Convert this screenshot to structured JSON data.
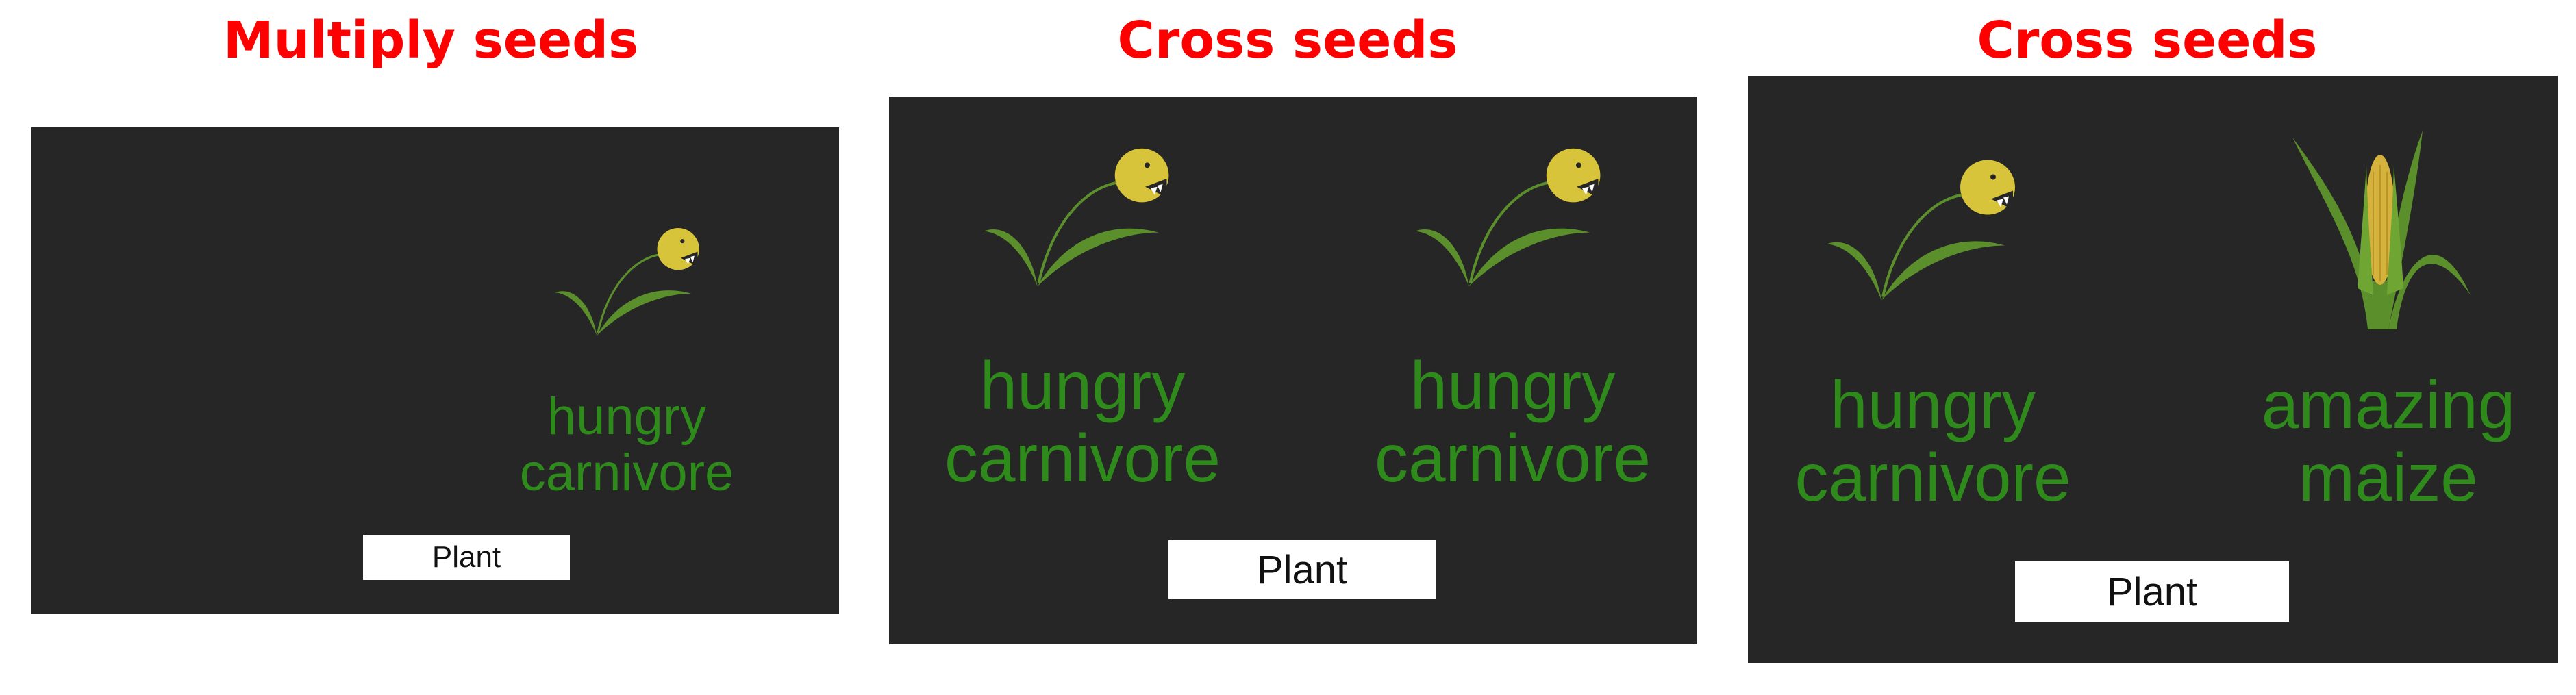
{
  "panels": [
    {
      "title": "Multiply seeds",
      "plants": [
        {
          "name_line1": "hungry",
          "name_line2": "carnivore",
          "icon": "hungry-carnivore-plant-icon"
        }
      ],
      "button_label": "Plant"
    },
    {
      "title": "Cross seeds",
      "plants": [
        {
          "name_line1": "hungry",
          "name_line2": "carnivore",
          "icon": "hungry-carnivore-plant-icon"
        },
        {
          "name_line1": "hungry",
          "name_line2": "carnivore",
          "icon": "hungry-carnivore-plant-icon"
        }
      ],
      "button_label": "Plant"
    },
    {
      "title": "Cross seeds",
      "plants": [
        {
          "name_line1": "hungry",
          "name_line2": "carnivore",
          "icon": "hungry-carnivore-plant-icon"
        },
        {
          "name_line1": "amazing",
          "name_line2": "maize",
          "icon": "maize-plant-icon"
        }
      ],
      "button_label": "Plant"
    }
  ],
  "colors": {
    "title": "#ff0000",
    "screen_background": "#262626",
    "plant_name": "#2f8a1c",
    "button_background": "#ffffff",
    "leaf": "#5b8f2c",
    "flower_head": "#d8c43a",
    "maize_cob": "#d4b23c"
  }
}
